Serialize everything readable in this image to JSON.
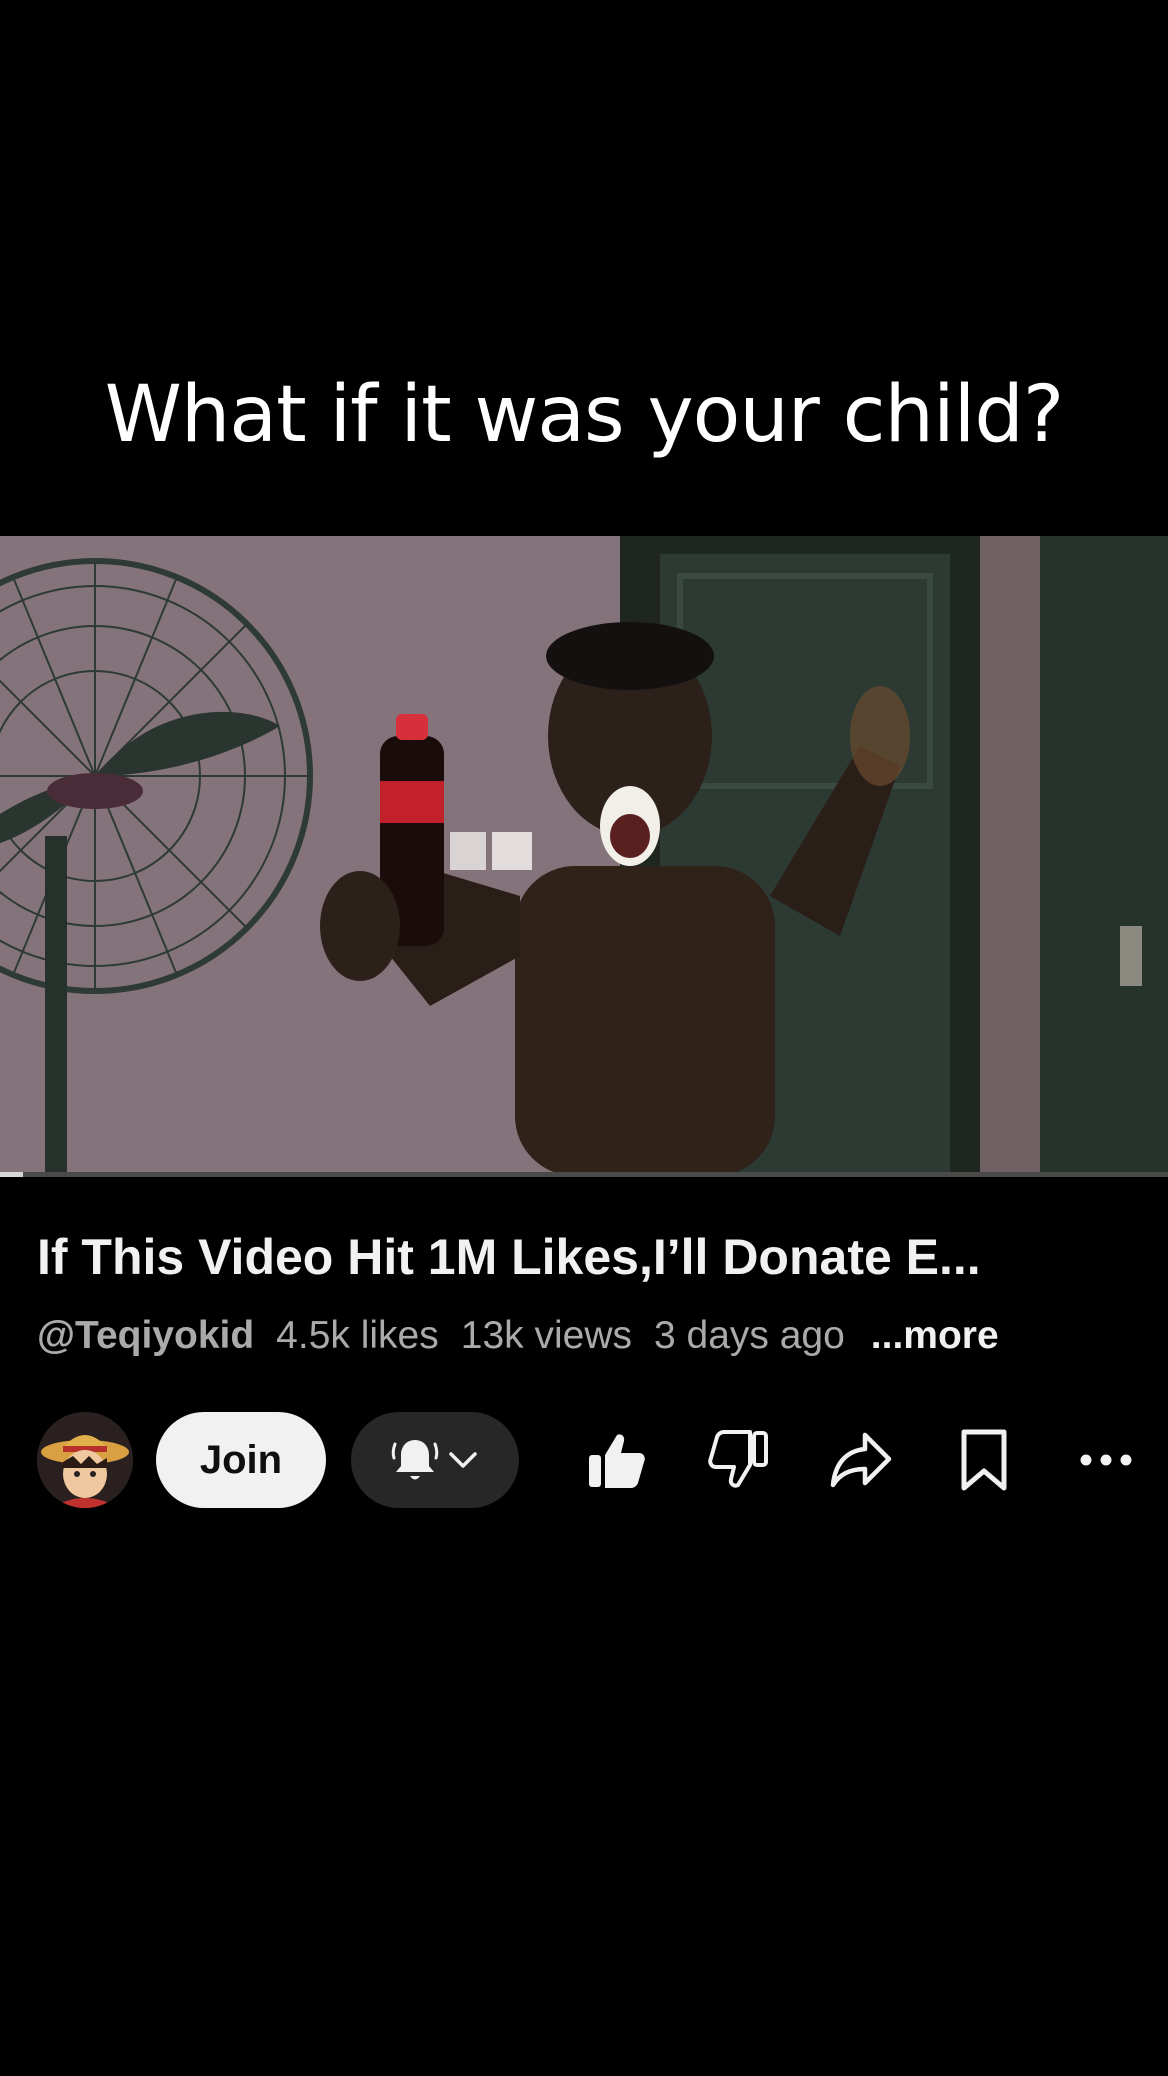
{
  "overlay": {
    "caption": "What if it was your child?"
  },
  "video": {
    "progress_fraction": 0.02
  },
  "info": {
    "title": "If This Video Hit 1M Likes,I’ll Donate E...",
    "channel_handle": "@Teqiyokid",
    "likes": "4.5k likes",
    "views": "13k views",
    "age": "3 days ago",
    "more_label": "...more"
  },
  "actions": {
    "join_label": "Join",
    "icons": [
      "avatar",
      "bell-icon",
      "chevron-down-icon",
      "thumbs-up-icon",
      "thumbs-down-icon",
      "share-icon",
      "save-icon",
      "more-icon"
    ]
  }
}
